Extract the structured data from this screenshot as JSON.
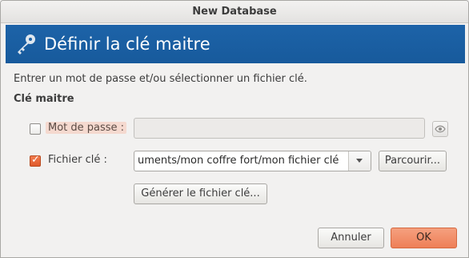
{
  "window": {
    "title": "New Database"
  },
  "banner": {
    "title": "Définir la clé maitre",
    "icon": "key-icon"
  },
  "intro": {
    "text": "Entrer un mot de passe et/ou sélectionner un fichier clé."
  },
  "section": {
    "heading": "Clé maitre"
  },
  "password": {
    "checked": false,
    "label": "Mot de passe :",
    "value": "",
    "toggle_icon": "eye-icon"
  },
  "keyfile": {
    "checked": true,
    "label": "Fichier  clé :",
    "path": "uments/mon coffre fort/mon fichier clé",
    "browse_label": "Parcourir..."
  },
  "generate": {
    "label": "Générer le fichier clé..."
  },
  "footer": {
    "cancel_label": "Annuler",
    "ok_label": "OK"
  },
  "colors": {
    "banner": "#1d63a8",
    "accent": "#ee7f57"
  }
}
